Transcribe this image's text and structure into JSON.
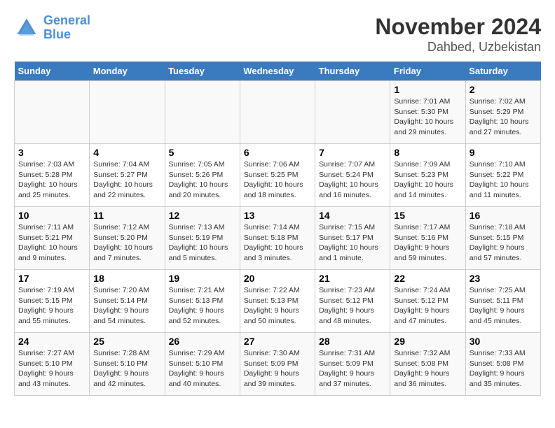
{
  "logo": {
    "line1": "General",
    "line2": "Blue"
  },
  "title": "November 2024",
  "subtitle": "Dahbed, Uzbekistan",
  "days_of_week": [
    "Sunday",
    "Monday",
    "Tuesday",
    "Wednesday",
    "Thursday",
    "Friday",
    "Saturday"
  ],
  "weeks": [
    [
      {
        "day": "",
        "info": ""
      },
      {
        "day": "",
        "info": ""
      },
      {
        "day": "",
        "info": ""
      },
      {
        "day": "",
        "info": ""
      },
      {
        "day": "",
        "info": ""
      },
      {
        "day": "1",
        "info": "Sunrise: 7:01 AM\nSunset: 5:30 PM\nDaylight: 10 hours and 29 minutes."
      },
      {
        "day": "2",
        "info": "Sunrise: 7:02 AM\nSunset: 5:29 PM\nDaylight: 10 hours and 27 minutes."
      }
    ],
    [
      {
        "day": "3",
        "info": "Sunrise: 7:03 AM\nSunset: 5:28 PM\nDaylight: 10 hours and 25 minutes."
      },
      {
        "day": "4",
        "info": "Sunrise: 7:04 AM\nSunset: 5:27 PM\nDaylight: 10 hours and 22 minutes."
      },
      {
        "day": "5",
        "info": "Sunrise: 7:05 AM\nSunset: 5:26 PM\nDaylight: 10 hours and 20 minutes."
      },
      {
        "day": "6",
        "info": "Sunrise: 7:06 AM\nSunset: 5:25 PM\nDaylight: 10 hours and 18 minutes."
      },
      {
        "day": "7",
        "info": "Sunrise: 7:07 AM\nSunset: 5:24 PM\nDaylight: 10 hours and 16 minutes."
      },
      {
        "day": "8",
        "info": "Sunrise: 7:09 AM\nSunset: 5:23 PM\nDaylight: 10 hours and 14 minutes."
      },
      {
        "day": "9",
        "info": "Sunrise: 7:10 AM\nSunset: 5:22 PM\nDaylight: 10 hours and 11 minutes."
      }
    ],
    [
      {
        "day": "10",
        "info": "Sunrise: 7:11 AM\nSunset: 5:21 PM\nDaylight: 10 hours and 9 minutes."
      },
      {
        "day": "11",
        "info": "Sunrise: 7:12 AM\nSunset: 5:20 PM\nDaylight: 10 hours and 7 minutes."
      },
      {
        "day": "12",
        "info": "Sunrise: 7:13 AM\nSunset: 5:19 PM\nDaylight: 10 hours and 5 minutes."
      },
      {
        "day": "13",
        "info": "Sunrise: 7:14 AM\nSunset: 5:18 PM\nDaylight: 10 hours and 3 minutes."
      },
      {
        "day": "14",
        "info": "Sunrise: 7:15 AM\nSunset: 5:17 PM\nDaylight: 10 hours and 1 minute."
      },
      {
        "day": "15",
        "info": "Sunrise: 7:17 AM\nSunset: 5:16 PM\nDaylight: 9 hours and 59 minutes."
      },
      {
        "day": "16",
        "info": "Sunrise: 7:18 AM\nSunset: 5:15 PM\nDaylight: 9 hours and 57 minutes."
      }
    ],
    [
      {
        "day": "17",
        "info": "Sunrise: 7:19 AM\nSunset: 5:15 PM\nDaylight: 9 hours and 55 minutes."
      },
      {
        "day": "18",
        "info": "Sunrise: 7:20 AM\nSunset: 5:14 PM\nDaylight: 9 hours and 54 minutes."
      },
      {
        "day": "19",
        "info": "Sunrise: 7:21 AM\nSunset: 5:13 PM\nDaylight: 9 hours and 52 minutes."
      },
      {
        "day": "20",
        "info": "Sunrise: 7:22 AM\nSunset: 5:13 PM\nDaylight: 9 hours and 50 minutes."
      },
      {
        "day": "21",
        "info": "Sunrise: 7:23 AM\nSunset: 5:12 PM\nDaylight: 9 hours and 48 minutes."
      },
      {
        "day": "22",
        "info": "Sunrise: 7:24 AM\nSunset: 5:12 PM\nDaylight: 9 hours and 47 minutes."
      },
      {
        "day": "23",
        "info": "Sunrise: 7:25 AM\nSunset: 5:11 PM\nDaylight: 9 hours and 45 minutes."
      }
    ],
    [
      {
        "day": "24",
        "info": "Sunrise: 7:27 AM\nSunset: 5:10 PM\nDaylight: 9 hours and 43 minutes."
      },
      {
        "day": "25",
        "info": "Sunrise: 7:28 AM\nSunset: 5:10 PM\nDaylight: 9 hours and 42 minutes."
      },
      {
        "day": "26",
        "info": "Sunrise: 7:29 AM\nSunset: 5:10 PM\nDaylight: 9 hours and 40 minutes."
      },
      {
        "day": "27",
        "info": "Sunrise: 7:30 AM\nSunset: 5:09 PM\nDaylight: 9 hours and 39 minutes."
      },
      {
        "day": "28",
        "info": "Sunrise: 7:31 AM\nSunset: 5:09 PM\nDaylight: 9 hours and 37 minutes."
      },
      {
        "day": "29",
        "info": "Sunrise: 7:32 AM\nSunset: 5:08 PM\nDaylight: 9 hours and 36 minutes."
      },
      {
        "day": "30",
        "info": "Sunrise: 7:33 AM\nSunset: 5:08 PM\nDaylight: 9 hours and 35 minutes."
      }
    ]
  ]
}
